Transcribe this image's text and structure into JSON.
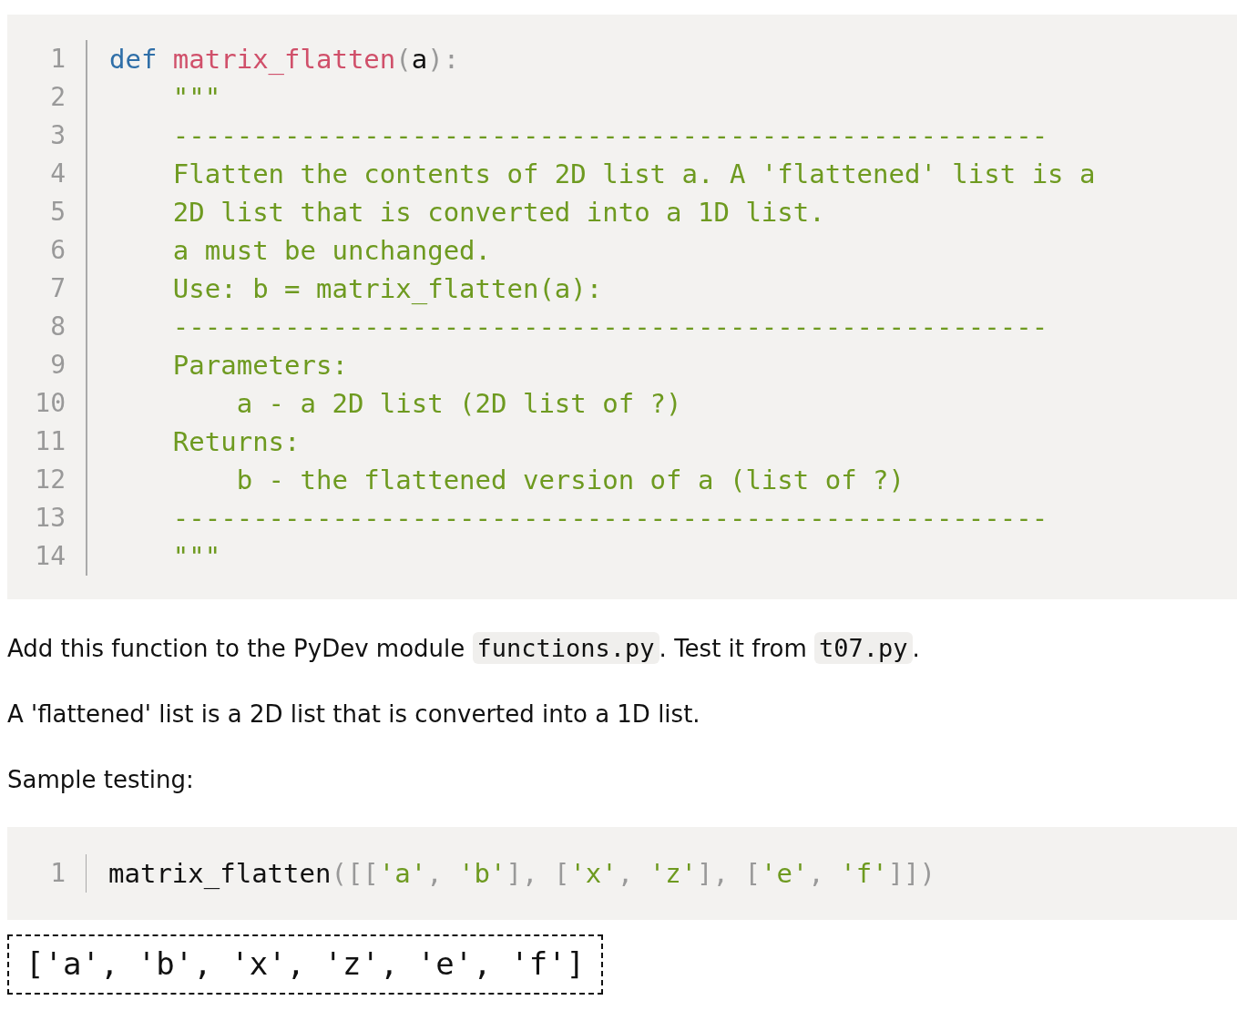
{
  "code_block": {
    "lines": [
      {
        "number": "1",
        "tokens": [
          {
            "kind": "keyword",
            "text": "def"
          },
          {
            "kind": "function",
            "text": " matrix_flatten"
          },
          {
            "kind": "punct",
            "text": "("
          },
          {
            "kind": "param",
            "text": "a"
          },
          {
            "kind": "punct",
            "text": "):"
          }
        ]
      },
      {
        "number": "2",
        "tokens": [
          {
            "kind": "string",
            "text": "    \"\"\""
          }
        ]
      },
      {
        "number": "3",
        "tokens": [
          {
            "kind": "string",
            "text": "    -------------------------------------------------------"
          }
        ]
      },
      {
        "number": "4",
        "tokens": [
          {
            "kind": "string",
            "text": "    Flatten the contents of 2D list a. A 'flattened' list is a"
          }
        ]
      },
      {
        "number": "5",
        "tokens": [
          {
            "kind": "string",
            "text": "    2D list that is converted into a 1D list."
          }
        ]
      },
      {
        "number": "6",
        "tokens": [
          {
            "kind": "string",
            "text": "    a must be unchanged."
          }
        ]
      },
      {
        "number": "7",
        "tokens": [
          {
            "kind": "string",
            "text": "    Use: b = matrix_flatten(a):"
          }
        ]
      },
      {
        "number": "8",
        "tokens": [
          {
            "kind": "string",
            "text": "    -------------------------------------------------------"
          }
        ]
      },
      {
        "number": "9",
        "tokens": [
          {
            "kind": "string",
            "text": "    Parameters:"
          }
        ]
      },
      {
        "number": "10",
        "tokens": [
          {
            "kind": "string",
            "text": "        a - a 2D list (2D list of ?)"
          }
        ]
      },
      {
        "number": "11",
        "tokens": [
          {
            "kind": "string",
            "text": "    Returns:"
          }
        ]
      },
      {
        "number": "12",
        "tokens": [
          {
            "kind": "string",
            "text": "        b - the flattened version of a (list of ?)"
          }
        ]
      },
      {
        "number": "13",
        "tokens": [
          {
            "kind": "string",
            "text": "    -------------------------------------------------------"
          }
        ]
      },
      {
        "number": "14",
        "tokens": [
          {
            "kind": "string",
            "text": "    \"\"\""
          }
        ]
      }
    ]
  },
  "paragraphs": [
    {
      "parts": [
        {
          "kind": "text",
          "text": "Add this function to the PyDev module "
        },
        {
          "kind": "code",
          "text": "functions.py"
        },
        {
          "kind": "text",
          "text": ". Test it from "
        },
        {
          "kind": "code",
          "text": "t07.py"
        },
        {
          "kind": "text",
          "text": "."
        }
      ]
    },
    {
      "parts": [
        {
          "kind": "text",
          "text": "A 'flattened' list is a 2D list that is converted into a 1D list."
        }
      ]
    },
    {
      "parts": [
        {
          "kind": "text",
          "text": "Sample testing:"
        }
      ]
    }
  ],
  "sample_block": {
    "lines": [
      {
        "number": "1",
        "tokens": [
          {
            "kind": "plain",
            "text": "matrix_flatten"
          },
          {
            "kind": "punct",
            "text": "([["
          },
          {
            "kind": "string",
            "text": "'a'"
          },
          {
            "kind": "punct",
            "text": ", "
          },
          {
            "kind": "string",
            "text": "'b'"
          },
          {
            "kind": "punct",
            "text": "], ["
          },
          {
            "kind": "string",
            "text": "'x'"
          },
          {
            "kind": "punct",
            "text": ", "
          },
          {
            "kind": "string",
            "text": "'z'"
          },
          {
            "kind": "punct",
            "text": "], ["
          },
          {
            "kind": "string",
            "text": "'e'"
          },
          {
            "kind": "punct",
            "text": ", "
          },
          {
            "kind": "string",
            "text": "'f'"
          },
          {
            "kind": "punct",
            "text": "]])"
          }
        ]
      }
    ]
  },
  "output": "['a', 'b', 'x', 'z', 'e', 'f']"
}
